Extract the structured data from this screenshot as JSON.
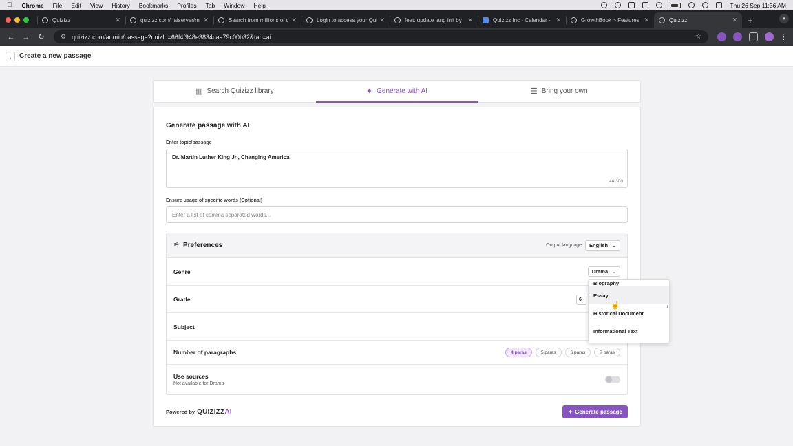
{
  "menubar": {
    "app": "Chrome",
    "items": [
      "File",
      "Edit",
      "View",
      "History",
      "Bookmarks",
      "Profiles",
      "Tab",
      "Window",
      "Help"
    ],
    "datetime": "Thu 26 Sep  11:36 AM"
  },
  "tabs": [
    {
      "title": "Quizizz",
      "active": false
    },
    {
      "title": "quizizz.com/_aiserver/m",
      "active": false
    },
    {
      "title": "Search from millions of q",
      "active": false
    },
    {
      "title": "Login to access your Qui",
      "active": false
    },
    {
      "title": "feat: update lang init by",
      "active": false
    },
    {
      "title": "Quizizz Inc - Calendar -",
      "active": false
    },
    {
      "title": "GrowthBook > Features",
      "active": false
    },
    {
      "title": "Quizizz",
      "active": true
    }
  ],
  "toolbar": {
    "url": "quizizz.com/admin/passage?quizId=66f4f948e3834caa79c00b32&tab=ai"
  },
  "page": {
    "title": "Create a new passage"
  },
  "mode_tabs": [
    {
      "label": "Search Quizizz library",
      "icon": "library-icon",
      "active": false
    },
    {
      "label": "Generate with AI",
      "icon": "sparkle-icon",
      "active": true
    },
    {
      "label": "Bring your own",
      "icon": "text-lines-icon",
      "active": false
    }
  ],
  "form": {
    "section_title": "Generate passage with AI",
    "topic_label": "Enter topic/passage",
    "topic_value": "Dr. Martin Luther King Jr., Changing America",
    "topic_count": "44/300",
    "words_label": "Ensure usage of specific words (Optional)",
    "words_placeholder": "Enter a list of comma separated words..."
  },
  "preferences": {
    "title": "Preferences",
    "output_language_label": "Output language",
    "output_language_value": "English",
    "genre_label": "Genre",
    "genre_value": "Drama",
    "grade_label": "Grade",
    "grade_value_partial": "6",
    "subject_label": "Subject",
    "paragraphs_label": "Number of paragraphs",
    "paragraph_options": [
      "4 paras",
      "5 paras",
      "6 paras",
      "7 paras"
    ],
    "paragraph_selected": "4 paras",
    "sources_label": "Use sources",
    "sources_sub": "Not available for Drama"
  },
  "genre_dropdown": {
    "items": [
      "Biography",
      "Essay",
      "Historical Document",
      "Informational Text"
    ],
    "hovered": "Essay"
  },
  "footer": {
    "powered_by": "Powered by",
    "brand": "QUIZIZZ",
    "brand_ai": "AI",
    "generate_label": "Generate passage"
  },
  "colors": {
    "accent": "#8854c0"
  }
}
